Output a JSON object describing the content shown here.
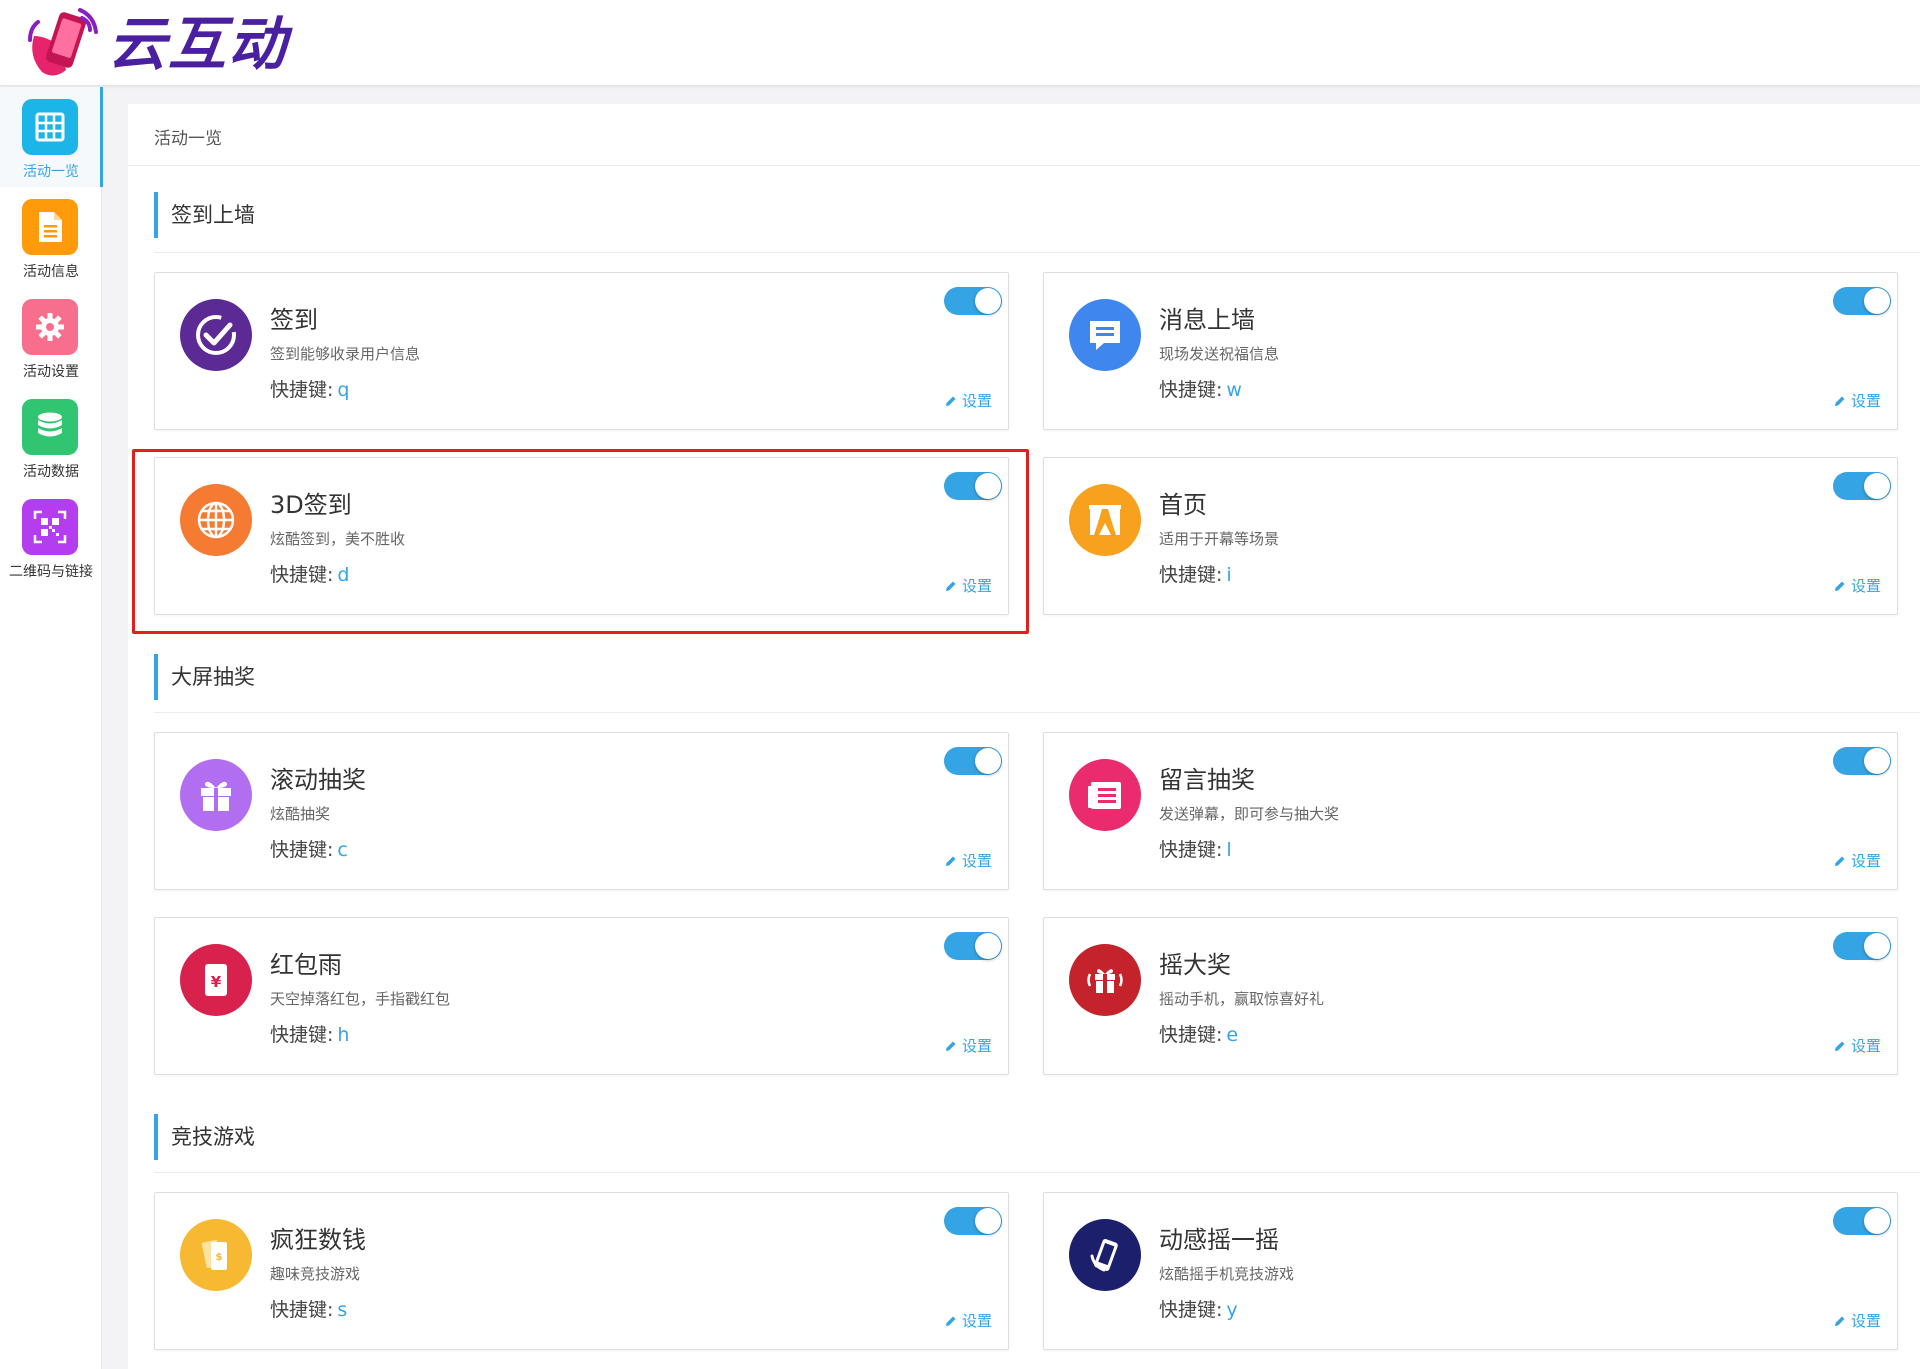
{
  "header": {
    "brand": "云互动"
  },
  "sidebar": {
    "items": [
      {
        "label": "活动一览",
        "icon": "grid-icon",
        "color": "#1cb5e8",
        "active": true
      },
      {
        "label": "活动信息",
        "icon": "document-icon",
        "color": "#ff9a0a",
        "active": false
      },
      {
        "label": "活动设置",
        "icon": "gear-icon",
        "color": "#f76f8c",
        "active": false
      },
      {
        "label": "活动数据",
        "icon": "database-icon",
        "color": "#2fc571",
        "active": false
      },
      {
        "label": "二维码与链接",
        "icon": "qrcode-icon",
        "color": "#b53df0",
        "active": false
      }
    ]
  },
  "breadcrumb": "活动一览",
  "key_label": "快捷键:",
  "settings_label": "设置",
  "sections": [
    {
      "title": "签到上墙",
      "cards": [
        {
          "title": "签到",
          "desc": "签到能够收录用户信息",
          "key": "q",
          "enabled": true,
          "icon": "checkmark-icon",
          "color": "#5b2a94"
        },
        {
          "title": "消息上墙",
          "desc": "现场发送祝福信息",
          "key": "w",
          "enabled": true,
          "icon": "message-icon",
          "color": "#3f86ef"
        },
        {
          "title": "3D签到",
          "desc": "炫酷签到，美不胜收",
          "key": "d",
          "enabled": true,
          "icon": "globe-icon",
          "color": "#f57a32"
        },
        {
          "title": "首页",
          "desc": "适用于开幕等场景",
          "key": "i",
          "enabled": true,
          "icon": "curtain-icon",
          "color": "#f7a11e"
        }
      ]
    },
    {
      "title": "大屏抽奖",
      "cards": [
        {
          "title": "滚动抽奖",
          "desc": "炫酷抽奖",
          "key": "c",
          "enabled": true,
          "icon": "gift-icon",
          "color": "#b26ef0"
        },
        {
          "title": "留言抽奖",
          "desc": "发送弹幕，即可参与抽大奖",
          "key": "l",
          "enabled": true,
          "icon": "notes-icon",
          "color": "#ea2b6e"
        },
        {
          "title": "红包雨",
          "desc": "天空掉落红包，手指戳红包",
          "key": "h",
          "enabled": true,
          "icon": "red-envelope-icon",
          "color": "#d8214d"
        },
        {
          "title": "摇大奖",
          "desc": "摇动手机，赢取惊喜好礼",
          "key": "e",
          "enabled": true,
          "icon": "shake-gift-icon",
          "color": "#c4232b"
        }
      ]
    },
    {
      "title": "竞技游戏",
      "cards": [
        {
          "title": "疯狂数钱",
          "desc": "趣味竞技游戏",
          "key": "s",
          "enabled": true,
          "icon": "money-icon",
          "color": "#f7b931"
        },
        {
          "title": "动感摇一摇",
          "desc": "炫酷摇手机竞技游戏",
          "key": "y",
          "enabled": true,
          "icon": "phone-shake-icon",
          "color": "#1c1f6b"
        }
      ]
    }
  ],
  "colors": {
    "accent": "#35a4e4",
    "highlight": "#e0201c",
    "brand": "#4a1fa0"
  }
}
